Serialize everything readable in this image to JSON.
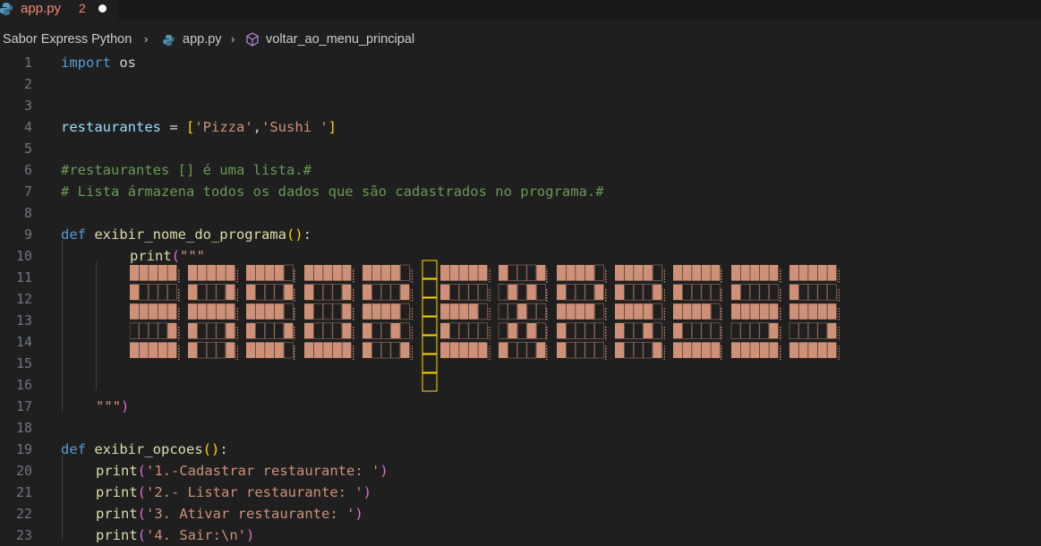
{
  "tab": {
    "icon": "python-icon",
    "filename": "app.py",
    "problems": "2",
    "modified": true,
    "color": "#f48771"
  },
  "breadcrumb": {
    "folder": "Sabor Express Python",
    "file": "app.py",
    "symbol": "voltar_ao_menu_principal",
    "file_icon": "python-icon",
    "symbol_icon": "cube-method-icon"
  },
  "editor": {
    "line_numbers": [
      "1",
      "2",
      "3",
      "4",
      "5",
      "6",
      "7",
      "8",
      "9",
      "10",
      "11",
      "12",
      "13",
      "14",
      "15",
      "16",
      "17",
      "18",
      "19",
      "20",
      "21",
      "22",
      "23"
    ],
    "line1": {
      "kw": "import",
      "mod": " os"
    },
    "line4": {
      "var": "restaurantes",
      "eq": " = ",
      "lb": "[",
      "s1": "'Pizza'",
      "comma": ",",
      "s2": "'Sushi '",
      "rb": "]"
    },
    "line6": "#restaurantes [] é uma lista.#",
    "line7": "# Lista ármazena todos os dados que são cadastrados no programa.#",
    "line9": {
      "kw": "def",
      "fn": " exibir_nome_do_programa",
      "paren": "()",
      "colon": ":"
    },
    "line10": {
      "fn": "print",
      "lp": "(",
      "str": "\"\"\""
    },
    "line17": {
      "str": "\"\"\"",
      "rp": ")"
    },
    "line19": {
      "kw": "def",
      "fn": " exibir_opcoes",
      "paren": "()",
      "colon": ":"
    },
    "prints": [
      {
        "fn": "print",
        "lp": "(",
        "str": "'1.-Cadastrar restaurante: '",
        "rp": ")"
      },
      {
        "fn": "print",
        "lp": "(",
        "str": "'2.- Listar restaurante: '",
        "rp": ")"
      },
      {
        "fn": "print",
        "lp": "(",
        "str": "'3. Ativar restaurante: '",
        "rp": ")"
      },
      {
        "fn": "print",
        "lp": "(",
        "str": "'4. Sair:\\n'",
        "rp": ")"
      }
    ],
    "ascii_art_color": "#ce9178"
  }
}
